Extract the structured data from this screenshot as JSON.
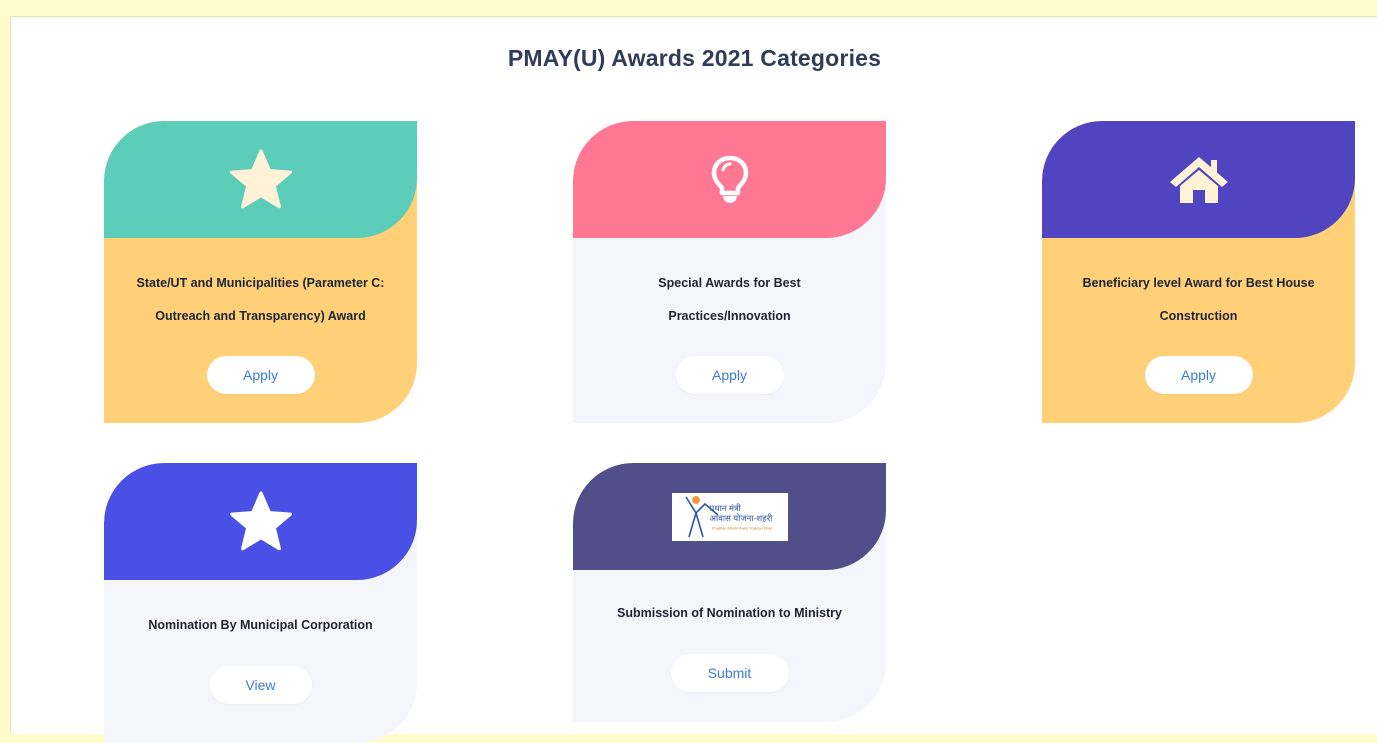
{
  "page": {
    "title": "PMAY(U) Awards 2021 Categories"
  },
  "cards": [
    {
      "title_line1": "State/UT and Municipalities (Parameter C:",
      "title_line2": "Outreach and Transparency) Award",
      "button_label": "Apply",
      "icon": "star-icon",
      "top_color": "#5ccdb9",
      "body_color": "#ffd077"
    },
    {
      "title_line1": "Special Awards for Best",
      "title_line2": "Practices/Innovation",
      "button_label": "Apply",
      "icon": "lightbulb-icon",
      "top_color": "#ff7893",
      "body_color": "#f5f6fb"
    },
    {
      "title_line1": "Beneficiary level Award for Best House",
      "title_line2": "Construction",
      "button_label": "Apply",
      "icon": "home-icon",
      "top_color": "#5044c0",
      "body_color": "#ffd077"
    },
    {
      "title_line1": "Nomination By Municipal Corporation",
      "button_label": "View",
      "icon": "star-icon",
      "top_color": "#4a4fe5",
      "body_color": "#f5f6fb"
    },
    {
      "title_line1": "Submission of Nomination to Ministry",
      "button_label": "Submit",
      "icon": "pmay-logo",
      "logo_text_line1": "प्रधान मंत्री",
      "logo_text_line2": "आवास योजना-शहरी",
      "logo_text_line3": "Pradhan Mantri Awas Yojana-Urban",
      "top_color": "#514f8a",
      "body_color": "#f5f6fb"
    }
  ]
}
